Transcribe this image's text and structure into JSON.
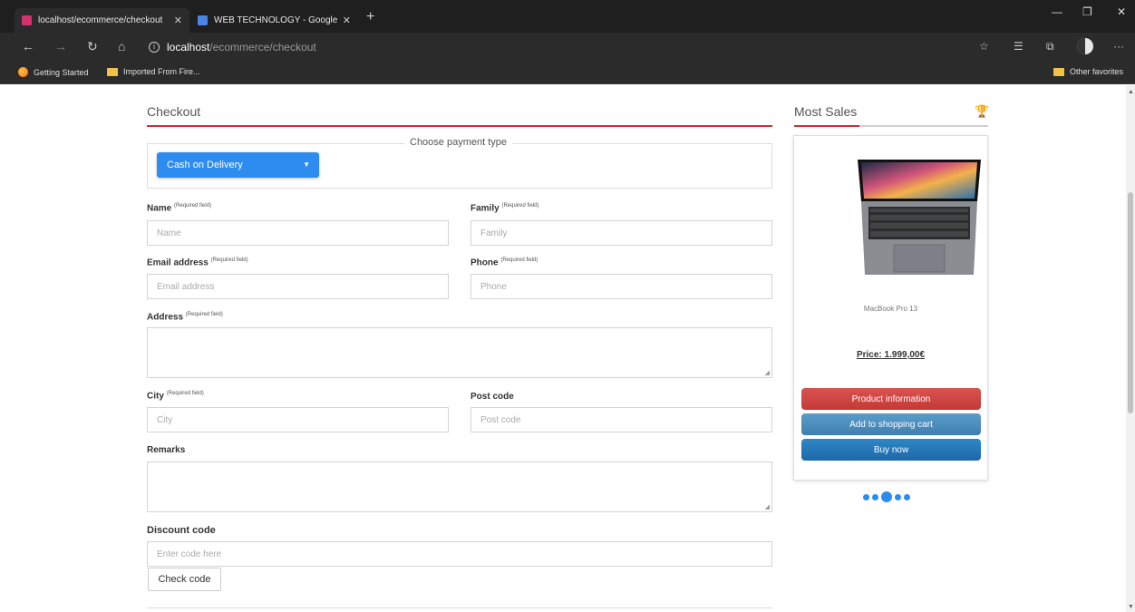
{
  "browser": {
    "tabs": [
      {
        "title": "localhost/ecommerce/checkout",
        "active": true,
        "favicon_color": "#d6336c"
      },
      {
        "title": "WEB TECHNOLOGY - Google Do",
        "active": false,
        "favicon_color": "#4a86e8"
      }
    ],
    "address": {
      "host": "localhost",
      "path": "/ecommerce/checkout"
    },
    "bookmarks": [
      {
        "label": "Getting Started",
        "icon": "firefox-icon"
      },
      {
        "label": "Imported From Fire...",
        "icon": "folder-icon"
      }
    ],
    "other_favorites": "Other favorites"
  },
  "checkout": {
    "title": "Checkout",
    "payment": {
      "legend": "Choose payment type",
      "selected": "Cash on Delivery"
    },
    "required_note": "(Required field)",
    "fields": {
      "name": {
        "label": "Name",
        "placeholder": "Name"
      },
      "family": {
        "label": "Family",
        "placeholder": "Family"
      },
      "email": {
        "label": "Email address",
        "placeholder": "Email address"
      },
      "phone": {
        "label": "Phone",
        "placeholder": "Phone"
      },
      "address": {
        "label": "Address"
      },
      "city": {
        "label": "City",
        "placeholder": "City"
      },
      "postcode": {
        "label": "Post code",
        "placeholder": "Post code"
      },
      "remarks": {
        "label": "Remarks"
      },
      "discount": {
        "label": "Discount code",
        "placeholder": "Enter code here"
      }
    },
    "check_code": "Check code"
  },
  "sidebar": {
    "title": "Most Sales",
    "product": {
      "name": "MacBook Pro 13",
      "price": "Price: 1.999,00€"
    },
    "buttons": {
      "info": "Product information",
      "cart": "Add to shopping cart",
      "buy": "Buy now"
    }
  },
  "colors": {
    "accent_red": "#c9302c",
    "primary_blue": "#2d8cf0"
  }
}
